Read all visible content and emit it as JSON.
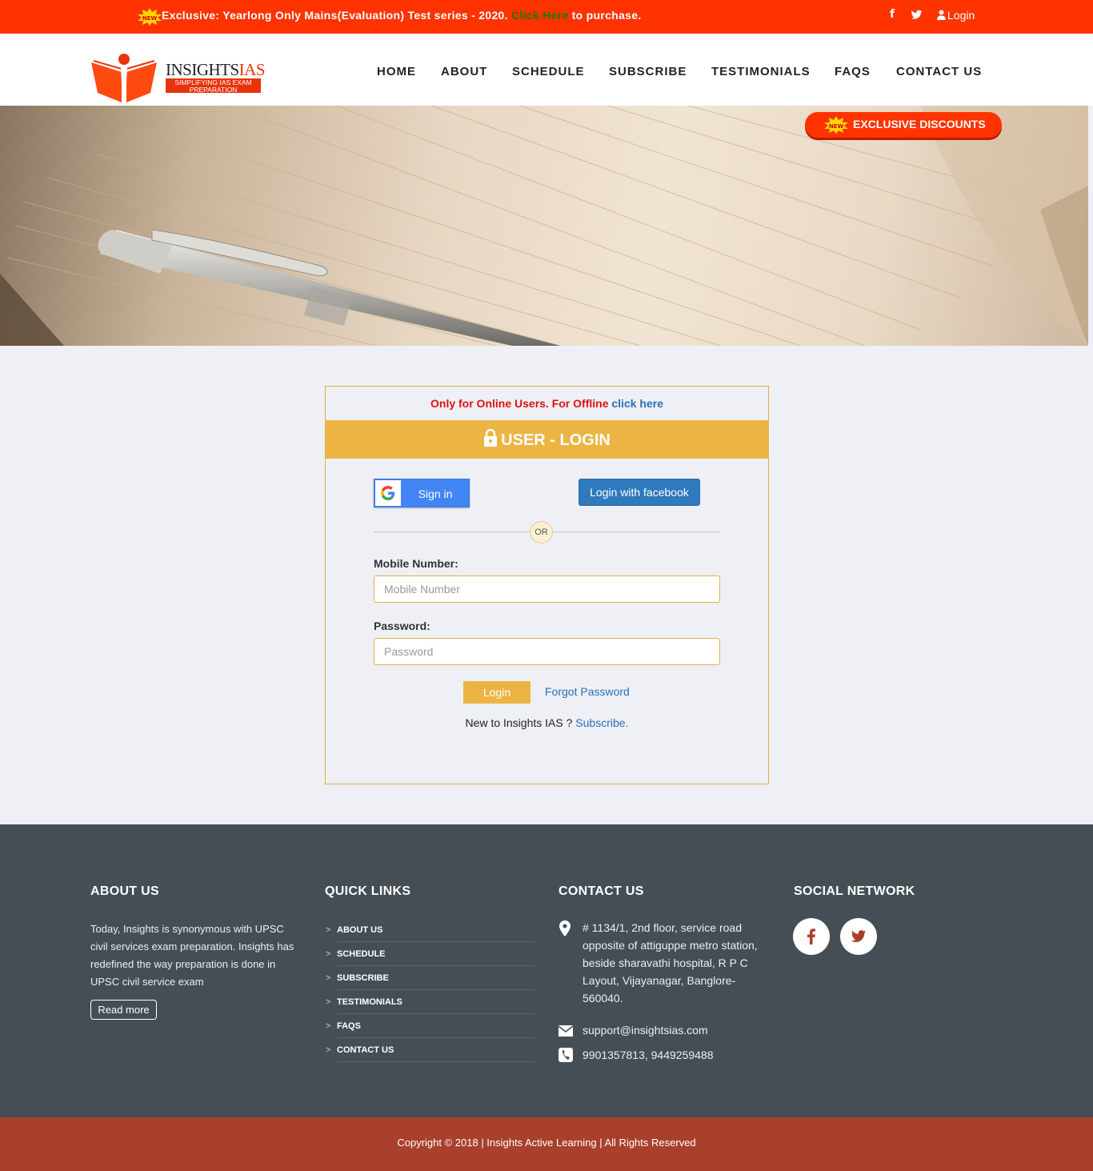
{
  "topbar": {
    "promo_prefix": "Exclusive: Yearlong Only Mains(Evaluation) Test series - 2020. ",
    "promo_link": "Click Here",
    "promo_suffix": " to purchase.",
    "facebook_glyph": "f",
    "login": "Login",
    "new_badge": "NEW"
  },
  "logo": {
    "brand_main": "INSIGHTS",
    "brand_accent": "IAS",
    "tagline": "SIMPLIFYING IAS EXAM PREPARATION"
  },
  "nav": [
    "HOME",
    "ABOUT",
    "SCHEDULE",
    "SUBSCRIBE",
    "TESTIMONIALS",
    "FAQS",
    "CONTACT US"
  ],
  "hero": {
    "discount_button": "EXCLUSIVE DISCOUNTS"
  },
  "login": {
    "offline_text": "Only for Online Users. For Offline ",
    "offline_link": "click here",
    "title": "USER - LOGIN",
    "google": "Sign in",
    "facebook": "Login with facebook",
    "or": "OR",
    "mobile_label": "Mobile Number:",
    "mobile_placeholder": "Mobile Number",
    "password_label": "Password:",
    "password_placeholder": "Password",
    "login_button": "Login",
    "forgot": "Forgot Password",
    "new_text": "New to Insights IAS ? ",
    "subscribe_link": "Subscribe."
  },
  "footer": {
    "about": {
      "heading": "ABOUT US",
      "text": "Today, Insights is synonymous with UPSC civil services exam preparation. Insights has redefined the way preparation is done in UPSC civil service exam",
      "read_more": "Read more"
    },
    "quick_links": {
      "heading": "QUICK LINKS",
      "items": [
        "ABOUT US",
        "SCHEDULE",
        "SUBSCRIBE",
        "TESTIMONIALS",
        "FAQS",
        "CONTACT US"
      ]
    },
    "contact": {
      "heading": "CONTACT US",
      "address": "# 1134/1, 2nd floor, service road opposite of attiguppe metro station, beside sharavathi hospital, R P C Layout, Vijayanagar, Banglore-560040.",
      "email": "support@insightsias.com",
      "phone": "9901357813, 9449259488"
    },
    "social": {
      "heading": "SOCIAL NETWORK",
      "icons": [
        "facebook-icon",
        "twitter-icon"
      ]
    },
    "copyright": "Copyright © 2018 | Insights Active Learning | All Rights Reserved"
  },
  "colors": {
    "accent_red": "#ff3300",
    "gold": "#ebb443",
    "footer_bg": "#454e55",
    "copyright_bg": "#a8402c",
    "link_blue": "#2a6ebb"
  }
}
